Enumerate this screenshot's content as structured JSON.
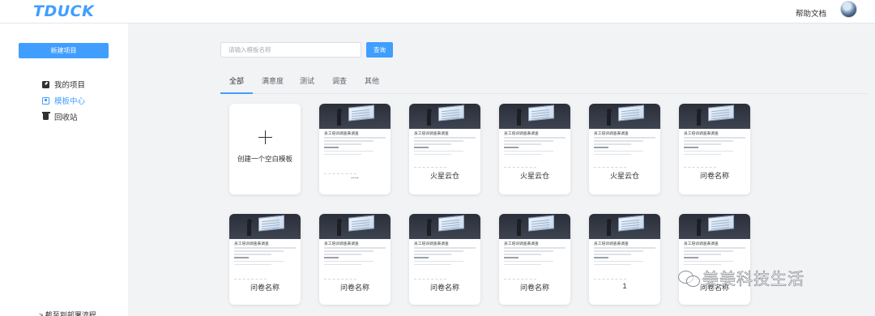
{
  "app": {
    "logo": "TDUCK",
    "help_link": "帮助文档"
  },
  "sidebar": {
    "new_button": "新建项目",
    "items": [
      {
        "label": "我的项目",
        "icon": "edit-icon"
      },
      {
        "label": "模板中心",
        "icon": "template-icon",
        "active": true
      },
      {
        "label": "回收站",
        "icon": "trash-icon"
      }
    ],
    "bottom_text": "> 截至到部署流程"
  },
  "search": {
    "placeholder": "请输入模板名称",
    "button": "查询"
  },
  "tabs": [
    {
      "label": "全部",
      "active": true
    },
    {
      "label": "满意度"
    },
    {
      "label": "测试"
    },
    {
      "label": "调查"
    },
    {
      "label": "其他"
    }
  ],
  "blank_card": {
    "label": "创建一个空白模板"
  },
  "template_preview": {
    "title": "员工培训调查表调查"
  },
  "row1_cards": [
    {
      "label": "...."
    },
    {
      "label": "火星云仓"
    },
    {
      "label": "火星云仓"
    },
    {
      "label": "火星云仓"
    },
    {
      "label": "问卷名称"
    }
  ],
  "row2_cards": [
    {
      "label": "问卷名称"
    },
    {
      "label": "问卷名称"
    },
    {
      "label": "问卷名称"
    },
    {
      "label": "问卷名称"
    },
    {
      "label": "1"
    },
    {
      "label": "问卷名称"
    }
  ],
  "watermark": {
    "text": "美美科技生活"
  },
  "colors": {
    "accent": "#409eff",
    "background": "#f2f3f5"
  }
}
